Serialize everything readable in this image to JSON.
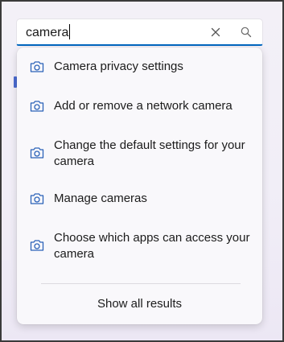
{
  "search": {
    "value": "camera"
  },
  "results": [
    {
      "label": "Camera privacy settings",
      "icon": "camera-icon"
    },
    {
      "label": "Add or remove a network camera",
      "icon": "camera-icon"
    },
    {
      "label": "Change the default settings for your camera",
      "icon": "camera-icon"
    },
    {
      "label": "Manage cameras",
      "icon": "camera-icon"
    },
    {
      "label": "Choose which apps can access your camera",
      "icon": "camera-icon"
    }
  ],
  "footer": {
    "show_all_label": "Show all results"
  },
  "colors": {
    "accent": "#0067c0",
    "icon": "#2b62b8",
    "text": "#1b1b1b"
  }
}
